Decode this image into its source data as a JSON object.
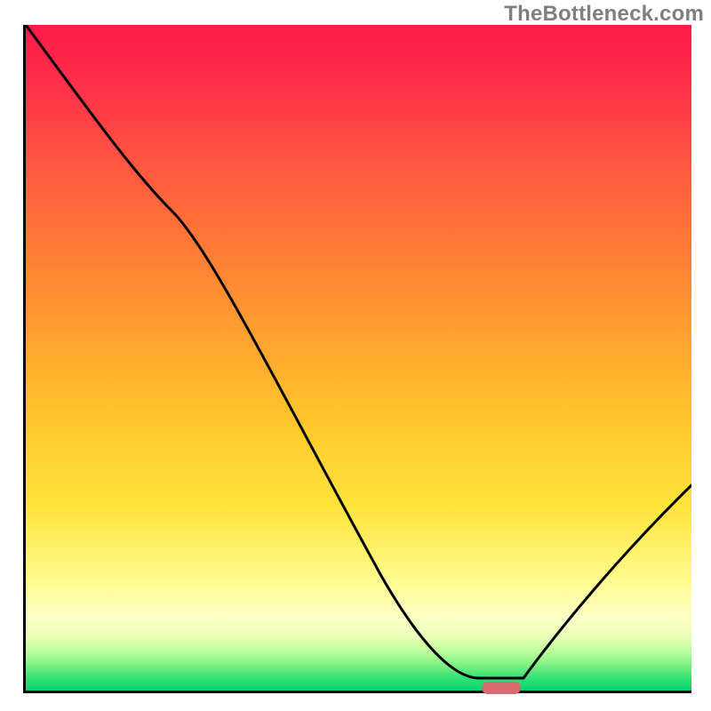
{
  "watermark": "TheBottleneck.com",
  "chart_data": {
    "type": "line",
    "title": "",
    "xlabel": "",
    "ylabel": "",
    "xlim": [
      0,
      100
    ],
    "ylim": [
      0,
      100
    ],
    "series": [
      {
        "name": "curve",
        "x": [
          0,
          22,
          68,
          75,
          100
        ],
        "values": [
          100,
          72,
          2,
          2,
          31
        ]
      }
    ],
    "marker": {
      "x_center": 71.5,
      "y": 1.5,
      "width_pct": 6
    },
    "background": "thermal-gradient"
  }
}
